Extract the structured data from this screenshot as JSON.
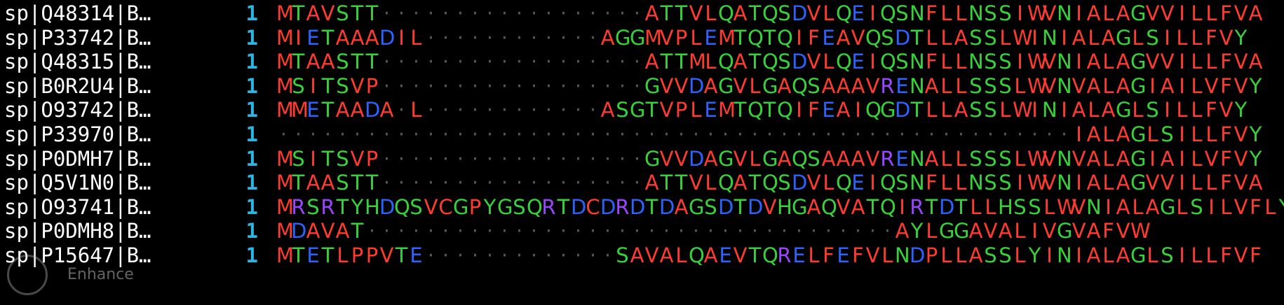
{
  "colors": {
    "background": "#000000",
    "hydrophobic": "#ff3b30",
    "polar": "#37d23a",
    "acidic": "#2c63ff",
    "basic": "#9a45ff",
    "methionine": "#ff3b30",
    "gap": "#555555",
    "start": "#2bb5e0",
    "label": "#ffffff"
  },
  "alignment": {
    "columns": 59,
    "rows": [
      {
        "id": "sp|Q48314|B…",
        "start": "1",
        "seq": "MTAVSTT------------------ATTVLQATQSDVLQEIQSNFLLNSSIWVNIALAGVVILLFVA"
      },
      {
        "id": "sp|P33742|B…",
        "start": "1",
        "seq": "MIETAAADIL------------AGGMVPLEMTQTQIFEAVQSDTLLASSLWINIALAGLSILLFVY"
      },
      {
        "id": "sp|Q48315|B…",
        "start": "1",
        "seq": "MTAASTT------------------ATTMLQATQSDVLQEIQSNFLLNSSIWVNIALAGVVILLFVA"
      },
      {
        "id": "sp|B0R2U4|B…",
        "start": "1",
        "seq": "MSITSVP------------------GVVDAGVLGAQSAAAVRENALLSSSLWVNVALAGIAILVFVY"
      },
      {
        "id": "sp|O93742|B…",
        "start": "1",
        "seq": "MMETAADA-L------------ASGTVPLEMTQTQIFEAIQGDTLLASSLWINIALAGLSILLFVY"
      },
      {
        "id": "sp|P33970|B…",
        "start": "1",
        "seq": "------------------------------------------------------IALAGLSILLFVY"
      },
      {
        "id": "sp|P0DMH7|B…",
        "start": "1",
        "seq": "MSITSVP------------------GVVDAGVLGAQSAAAVRENALLSSSLWVNVALAGIAILVFVY"
      },
      {
        "id": "sp|Q5V1N0|B…",
        "start": "1",
        "seq": "MTAASTT------------------ATTVLQATQSDVLQEIQSNFLLNSSIWVNIALAGVVILLFVA"
      },
      {
        "id": "sp|O93741|B…",
        "start": "1",
        "seq": "MRSRTYHDQSVCGPYGSQRTDCDRDTDAGSDTDVHGAQVATQIRTDTLLHSSLWVNIALAGLSILVFLY"
      },
      {
        "id": "sp|P0DMH8|B…",
        "start": "1",
        "seq": "MDAVAT------------------------------------AYLGGAVALIVGVAFVW"
      },
      {
        "id": "sp|P15647|B…",
        "start": "1",
        "seq": "MTETLPPVTE-------------SAVALQAEVTQRELFEFVLNDPLLASSLYINIALAGLSILLFVF"
      }
    ]
  },
  "watermark": {
    "text": "Enhance"
  },
  "icons": {
    "watermark_logo": "circle-logo-icon"
  }
}
